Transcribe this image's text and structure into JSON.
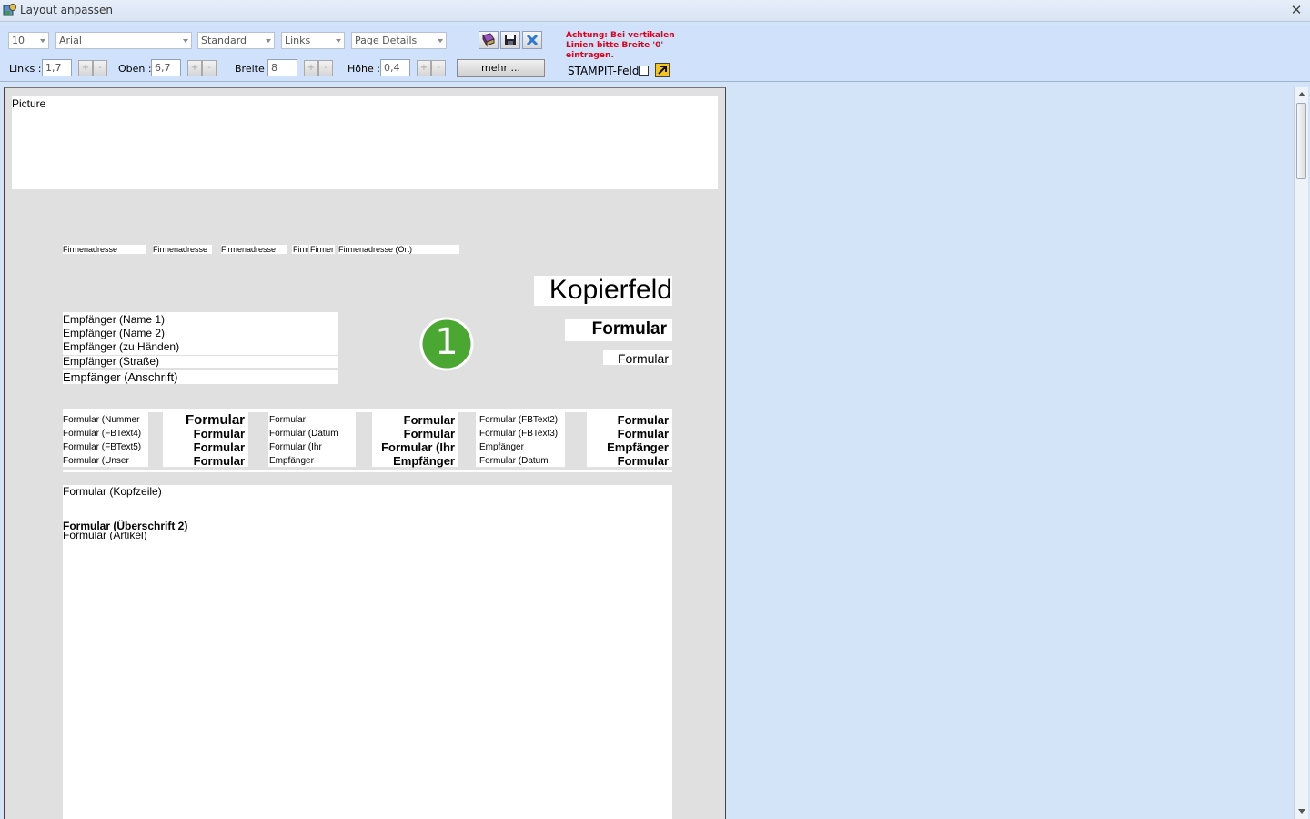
{
  "window": {
    "title": "Layout anpassen",
    "close_glyph": "✕"
  },
  "toolbar": {
    "font_size": "10",
    "font_family": "Arial",
    "style": "Standard",
    "alignment": "Links",
    "section": "Page Details",
    "links_label": "Links :",
    "links_value": "1,7",
    "oben_label": "Oben :",
    "oben_value": "6,7",
    "breite_label": "Breite :",
    "breite_value": "8",
    "hoehe_label": "Höhe :",
    "hoehe_value": "0,4",
    "spin_plus": "+",
    "spin_minus": "-",
    "more_label": "mehr ...",
    "warning": "Achtung: Bei vertikalen Linien bitte Breite '0' eintragen.",
    "stampit_label": "STAMPIT-Feld",
    "icons": [
      "book-icon",
      "save-icon",
      "delete-icon"
    ]
  },
  "canvas": {
    "picture_label": "Picture",
    "firmenadresse": [
      "Firmenadresse",
      "Firmenadresse",
      "Firmenadresse",
      "Firm",
      "Firmer",
      "Firmenadresse (Ort)"
    ],
    "kopierfeld": "Kopierfeld",
    "formular_big": "Formular",
    "formular_small": "Formular",
    "badge_number": "1",
    "badge_color": "#4aa832",
    "recipient": [
      "Empfänger (Name 1)",
      "Empfänger (Name 2)",
      "Empfänger (zu Händen)",
      "Empfänger (Straße)"
    ],
    "recipient_address": "Empfänger (Anschrift)",
    "info_col1": [
      "Formular (Nummer",
      "Formular (FBText4)",
      "Formular (FBText5)",
      "Formular (Unser"
    ],
    "info_col2": [
      "Formular",
      "Formular",
      "Formular",
      "Formular"
    ],
    "info_col3": [
      "Formular",
      "Formular (Datum",
      "Formular (Ihr",
      "Empfänger"
    ],
    "info_col4": [
      "Formular",
      "Formular",
      "Formular (Ihr",
      "Empfänger"
    ],
    "info_col5": [
      "Formular (FBText2)",
      "Formular (FBText3)",
      "Empfänger",
      "Formular (Datum"
    ],
    "info_col6": [
      "Formular",
      "Formular",
      "Empfänger",
      "Formular"
    ],
    "kopfzeile": "Formular (Kopfzeile)",
    "ueberschrift": "Formular (Überschrift 2)",
    "artikel": "Formular (Artikel)"
  },
  "colors": {
    "panel_bg": "#d0e2fb",
    "warning": "#e0001c"
  }
}
